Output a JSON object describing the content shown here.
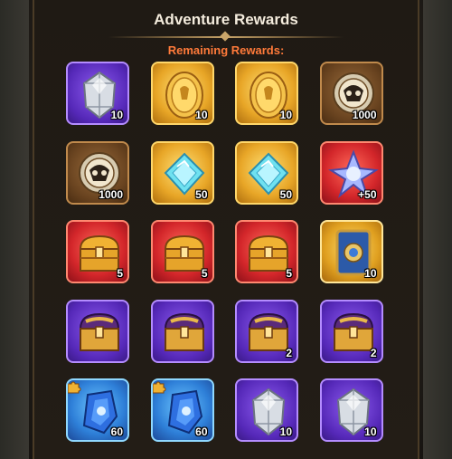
{
  "header": {
    "title": "Adventure Rewards",
    "subtitle": "Remaining Rewards:"
  },
  "rewards": [
    {
      "icon": "silver-gem-icon",
      "frame": "purple",
      "qty": "10"
    },
    {
      "icon": "gold-coin-icon",
      "frame": "gold",
      "qty": "10"
    },
    {
      "icon": "gold-coin-icon",
      "frame": "gold",
      "qty": "10"
    },
    {
      "icon": "bronze-medal-icon",
      "frame": "bronze",
      "qty": "1000"
    },
    {
      "icon": "bronze-medal-icon",
      "frame": "bronze",
      "qty": "1000"
    },
    {
      "icon": "cyan-crystal-icon",
      "frame": "gold",
      "qty": "50"
    },
    {
      "icon": "cyan-crystal-icon",
      "frame": "gold",
      "qty": "50"
    },
    {
      "icon": "star-crystal-icon",
      "frame": "red",
      "qty": "+50"
    },
    {
      "icon": "gold-chest-icon",
      "frame": "red",
      "qty": "5"
    },
    {
      "icon": "gold-chest-icon",
      "frame": "red",
      "qty": "5"
    },
    {
      "icon": "gold-chest-icon",
      "frame": "red",
      "qty": "5"
    },
    {
      "icon": "blue-card-icon",
      "frame": "gold-card",
      "qty": "10"
    },
    {
      "icon": "purple-chest-icon",
      "frame": "purple",
      "qty": ""
    },
    {
      "icon": "purple-chest-icon",
      "frame": "purple",
      "qty": ""
    },
    {
      "icon": "purple-chest-icon",
      "frame": "purple",
      "qty": "2"
    },
    {
      "icon": "purple-chest-icon",
      "frame": "purple",
      "qty": "2"
    },
    {
      "icon": "blue-shard-icon",
      "frame": "blue",
      "qty": "60",
      "puzzle": true
    },
    {
      "icon": "blue-shard-icon",
      "frame": "blue",
      "qty": "60",
      "puzzle": true
    },
    {
      "icon": "silver-gem-icon",
      "frame": "purple",
      "qty": "10"
    },
    {
      "icon": "silver-gem-icon",
      "frame": "purple",
      "qty": "10"
    }
  ]
}
